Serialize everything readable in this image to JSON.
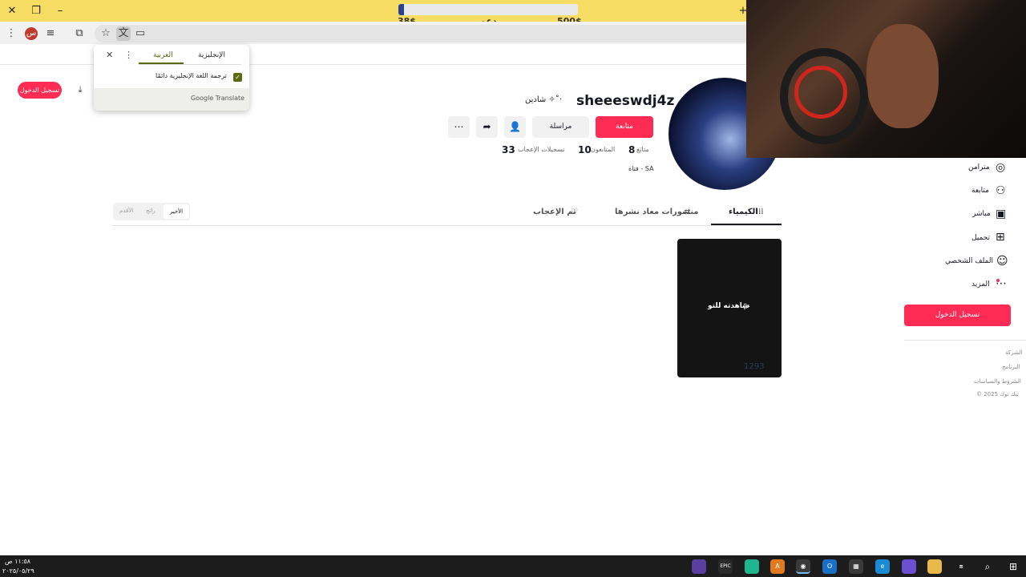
{
  "titlebar": {
    "donation_min": "38$",
    "donation_label": "دعم",
    "donation_max": "500$",
    "donation_progress": 0.03
  },
  "toolbar": {
    "profile_initial": "س"
  },
  "translate_popup": {
    "tab_source": "الإنجليزية",
    "tab_target": "العربية",
    "always_translate_label": "ترجمة اللغة الإنجليزية دائمًا",
    "brand": "Google Translate"
  },
  "page": {
    "login_small_label": "تسجيل الدخول",
    "username": "sheeeswdj4z",
    "nickname": "شادين ✧˚‧",
    "follow_label": "متابعة",
    "message_label": "مراسلة",
    "stats": {
      "following_count": "8",
      "following_label": "متابَع",
      "followers_count": "10",
      "followers_label": "المتابعون",
      "likes_count": "33",
      "likes_label": "تسجيلات الإعجاب"
    },
    "bio": "فتاة - SA",
    "tabs": {
      "videos": "الكيمياء",
      "reposts": "منشورات معاد نشرها",
      "liked": "تم الإعجاب"
    },
    "sort": {
      "latest": "الأخير",
      "popular": "رائج",
      "oldest": "الأقدم"
    },
    "video": {
      "caption": "شاهدته للتو",
      "views": "1293"
    }
  },
  "sidebar": {
    "items": [
      {
        "label": "مترامن",
        "icon": "compass-icon"
      },
      {
        "label": "متابعة",
        "icon": "user-plus-icon"
      },
      {
        "label": "مباشر",
        "icon": "live-tv-icon"
      },
      {
        "label": "تحميل",
        "icon": "upload-plus-icon"
      },
      {
        "label": "الملف الشخصي",
        "icon": "profile-icon"
      },
      {
        "label": "المزيد",
        "icon": "more-icon"
      }
    ],
    "login_label": "تسجيل الدخول",
    "footer": [
      "الشركة",
      "البرنامج",
      "الشروط والسياسات",
      "© 2025 تيك توك"
    ]
  },
  "taskbar": {
    "time": "١١:٥٨ ص",
    "date": "٢٠٢٥/٠٥/٢٩"
  },
  "colors": {
    "accent": "#fe2c55",
    "titlebar": "#f7dd63",
    "translate_accent": "#5b6b12"
  }
}
